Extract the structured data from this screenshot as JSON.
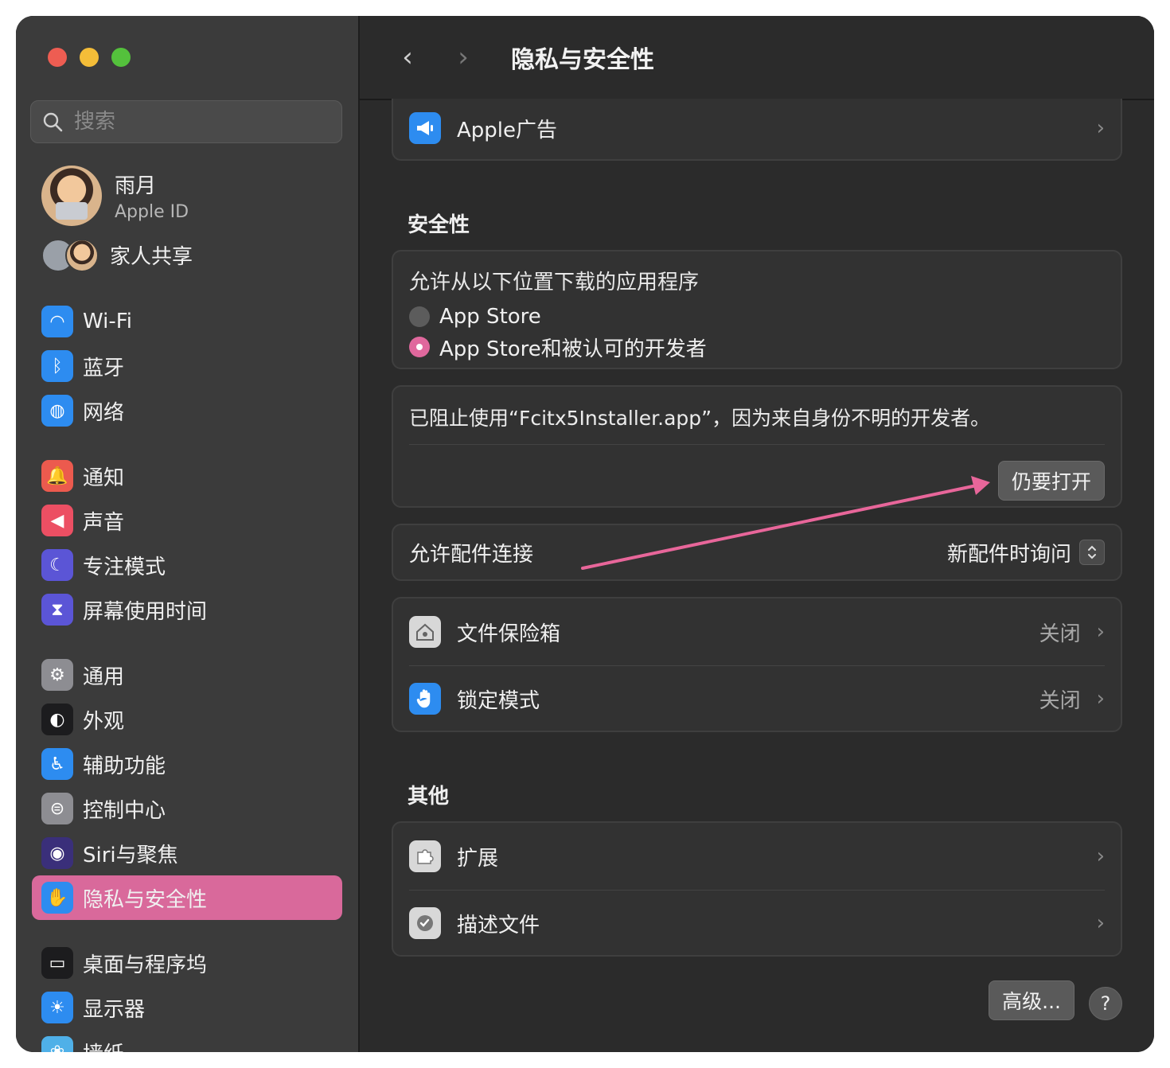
{
  "window": {
    "title": "隐私与安全性"
  },
  "colors": {
    "accent": "#d9699b",
    "sidebar_bg": "#3b3b3b",
    "main_bg": "#2b2b2b"
  },
  "search": {
    "placeholder": "搜索"
  },
  "profile": {
    "name": "雨月",
    "sub": "Apple ID"
  },
  "family": {
    "label": "家人共享"
  },
  "sidebar": {
    "items": [
      {
        "label": "Wi-Fi",
        "icon": "wifi-icon",
        "color": "#2d8cf0"
      },
      {
        "label": "蓝牙",
        "icon": "bluetooth-icon",
        "color": "#2d8cf0"
      },
      {
        "label": "网络",
        "icon": "globe-icon",
        "color": "#2d8cf0"
      },
      {
        "label": "通知",
        "icon": "bell-icon",
        "color": "#ec5a4e"
      },
      {
        "label": "声音",
        "icon": "speaker-icon",
        "color": "#ec4f63"
      },
      {
        "label": "专注模式",
        "icon": "moon-icon",
        "color": "#5b55d6"
      },
      {
        "label": "屏幕使用时间",
        "icon": "hourglass-icon",
        "color": "#5b55d6"
      },
      {
        "label": "通用",
        "icon": "gear-icon",
        "color": "#8d8d92"
      },
      {
        "label": "外观",
        "icon": "appearance-icon",
        "color": "#1c1c1e"
      },
      {
        "label": "辅助功能",
        "icon": "accessibility-icon",
        "color": "#2d8cf0"
      },
      {
        "label": "控制中心",
        "icon": "toggles-icon",
        "color": "#8d8d92"
      },
      {
        "label": "Siri与聚焦",
        "icon": "siri-icon",
        "color": "#3a2f7a"
      },
      {
        "label": "隐私与安全性",
        "icon": "hand-icon",
        "color": "#2d8cf0"
      },
      {
        "label": "桌面与程序坞",
        "icon": "dock-icon",
        "color": "#1c1c1e"
      },
      {
        "label": "显示器",
        "icon": "sun-icon",
        "color": "#2d8cf0"
      },
      {
        "label": "墙纸",
        "icon": "wallpaper-icon",
        "color": "#4fb0e8"
      }
    ]
  },
  "toolbar": {
    "back": "‹",
    "forward": "›"
  },
  "ads": {
    "label": "Apple广告",
    "icon": "megaphone-icon"
  },
  "security": {
    "title": "安全性",
    "download_heading": "允许从以下位置下载的应用程序",
    "options": [
      "App Store",
      "App Store和被认可的开发者"
    ],
    "selected_index": 1,
    "blocked_message": "已阻止使用“Fcitx5Installer.app”，因为来自身份不明的开发者。",
    "open_anyway": "仍要打开",
    "accessory_label": "允许配件连接",
    "accessory_value": "新配件时询问",
    "filevault_label": "文件保险箱",
    "filevault_value": "关闭",
    "lockdown_label": "锁定模式",
    "lockdown_value": "关闭"
  },
  "other": {
    "title": "其他",
    "extensions": "扩展",
    "profiles": "描述文件"
  },
  "footer": {
    "advanced": "高级...",
    "help": "?"
  }
}
